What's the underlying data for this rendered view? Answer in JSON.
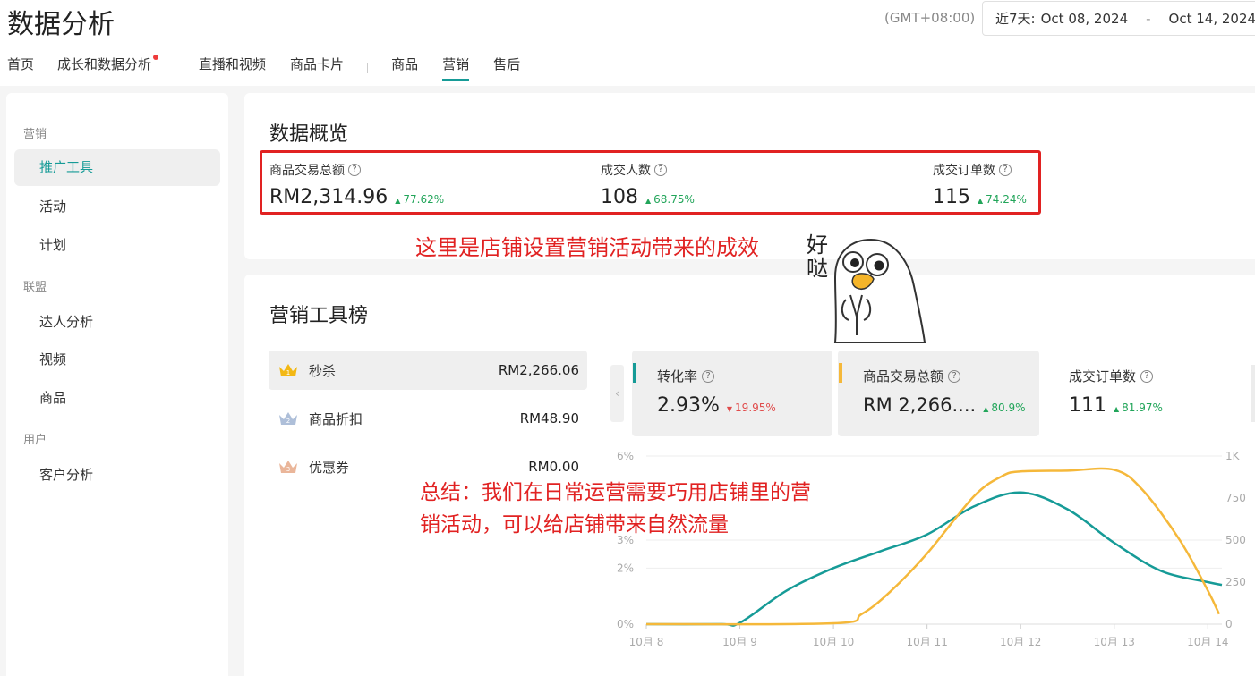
{
  "header": {
    "title": "数据分析",
    "timezone": "(GMT+08:00)",
    "date_range": {
      "preset": "近7天:",
      "start": "Oct 08, 2024",
      "separator": "-",
      "end": "Oct 14, 2024"
    }
  },
  "nav": {
    "tabs": [
      "首页",
      "成长和数据分析",
      "直播和视频",
      "商品卡片",
      "商品",
      "营销",
      "售后"
    ],
    "active": "营销",
    "badge_color": "#ee3b3b"
  },
  "sidebar": {
    "groups": [
      {
        "title": "营销",
        "items": [
          "推广工具",
          "活动",
          "计划"
        ]
      },
      {
        "title": "联盟",
        "items": [
          "达人分析",
          "视频",
          "商品"
        ]
      },
      {
        "title": "用户",
        "items": [
          "客户分析"
        ]
      }
    ],
    "active": "推广工具"
  },
  "overview": {
    "title": "数据概览",
    "metrics": [
      {
        "label": "商品交易总额",
        "value": "RM2,314.96",
        "change": "77.62%",
        "trend": "up"
      },
      {
        "label": "成交人数",
        "value": "108",
        "change": "68.75%",
        "trend": "up"
      },
      {
        "label": "成交订单数",
        "value": "115",
        "change": "74.24%",
        "trend": "up"
      }
    ]
  },
  "annotations": {
    "overview_note": "这里是店铺设置营销活动带来的成效",
    "summary": "总结：我们在日常运营需要巧用店铺里的营销活动，可以给店铺带来自然流量"
  },
  "sticker": {
    "text1": "好",
    "text2": "哒"
  },
  "tools": {
    "title": "营销工具榜",
    "ranking": [
      {
        "rank": "1",
        "name": "秒杀",
        "amount": "RM2,266.06",
        "medal_color": "#f3b814"
      },
      {
        "rank": "2",
        "name": "商品折扣",
        "amount": "RM48.90",
        "medal_color": "#8fa6c9"
      },
      {
        "rank": "3",
        "name": "优惠券",
        "amount": "RM0.00",
        "medal_color": "#e0a583"
      }
    ],
    "kpis": [
      {
        "label": "转化率",
        "value": "2.93%",
        "change": "19.95%",
        "trend": "down",
        "marker_color": "#169b97",
        "selected": true
      },
      {
        "label": "商品交易总额",
        "value": "RM 2,266....",
        "change": "80.9%",
        "trend": "up",
        "marker_color": "#f5b83a",
        "selected": true
      },
      {
        "label": "成交订单数",
        "value": "111",
        "change": "81.97%",
        "trend": "up",
        "marker_color": "",
        "selected": false
      }
    ],
    "prev_icon": "chevron-left-icon"
  },
  "chart_data": {
    "type": "line",
    "x": [
      "10月 8",
      "10月 9",
      "10月 10",
      "10月 11",
      "10月 12",
      "10月 13",
      "10月 14"
    ],
    "left_axis": {
      "ticks": [
        "0%",
        "1%",
        "2%",
        "3%",
        "4%",
        "5%",
        "6%"
      ],
      "ylim": [
        0,
        6
      ],
      "visible_ticks": [
        "0%",
        "2%",
        "3%",
        "6%"
      ]
    },
    "right_axis": {
      "ticks": [
        "0",
        "250",
        "500",
        "750",
        "1K"
      ],
      "ylim": [
        0,
        1000
      ]
    },
    "grid": true,
    "series": [
      {
        "name": "转化率",
        "axis": "left",
        "color": "#169b97",
        "points": [
          [
            0,
            0
          ],
          [
            0.8,
            0
          ],
          [
            1,
            0.05
          ],
          [
            1.5,
            1.2
          ],
          [
            2,
            2.0
          ],
          [
            2.5,
            2.6
          ],
          [
            3,
            3.2
          ],
          [
            3.5,
            4.2
          ],
          [
            4,
            4.7
          ],
          [
            4.5,
            4.1
          ],
          [
            5,
            2.9
          ],
          [
            5.5,
            1.9
          ],
          [
            6,
            1.5
          ],
          [
            6.15,
            1.4
          ]
        ]
      },
      {
        "name": "商品交易总额",
        "axis": "right",
        "color": "#f5b83a",
        "points": [
          [
            0,
            0
          ],
          [
            2,
            5
          ],
          [
            2.3,
            60
          ],
          [
            2.6,
            190
          ],
          [
            3,
            420
          ],
          [
            3.5,
            760
          ],
          [
            3.8,
            880
          ],
          [
            4,
            908
          ],
          [
            4.5,
            913
          ],
          [
            5,
            918
          ],
          [
            5.3,
            800
          ],
          [
            5.7,
            500
          ],
          [
            6,
            200
          ],
          [
            6.12,
            60
          ]
        ]
      }
    ]
  }
}
